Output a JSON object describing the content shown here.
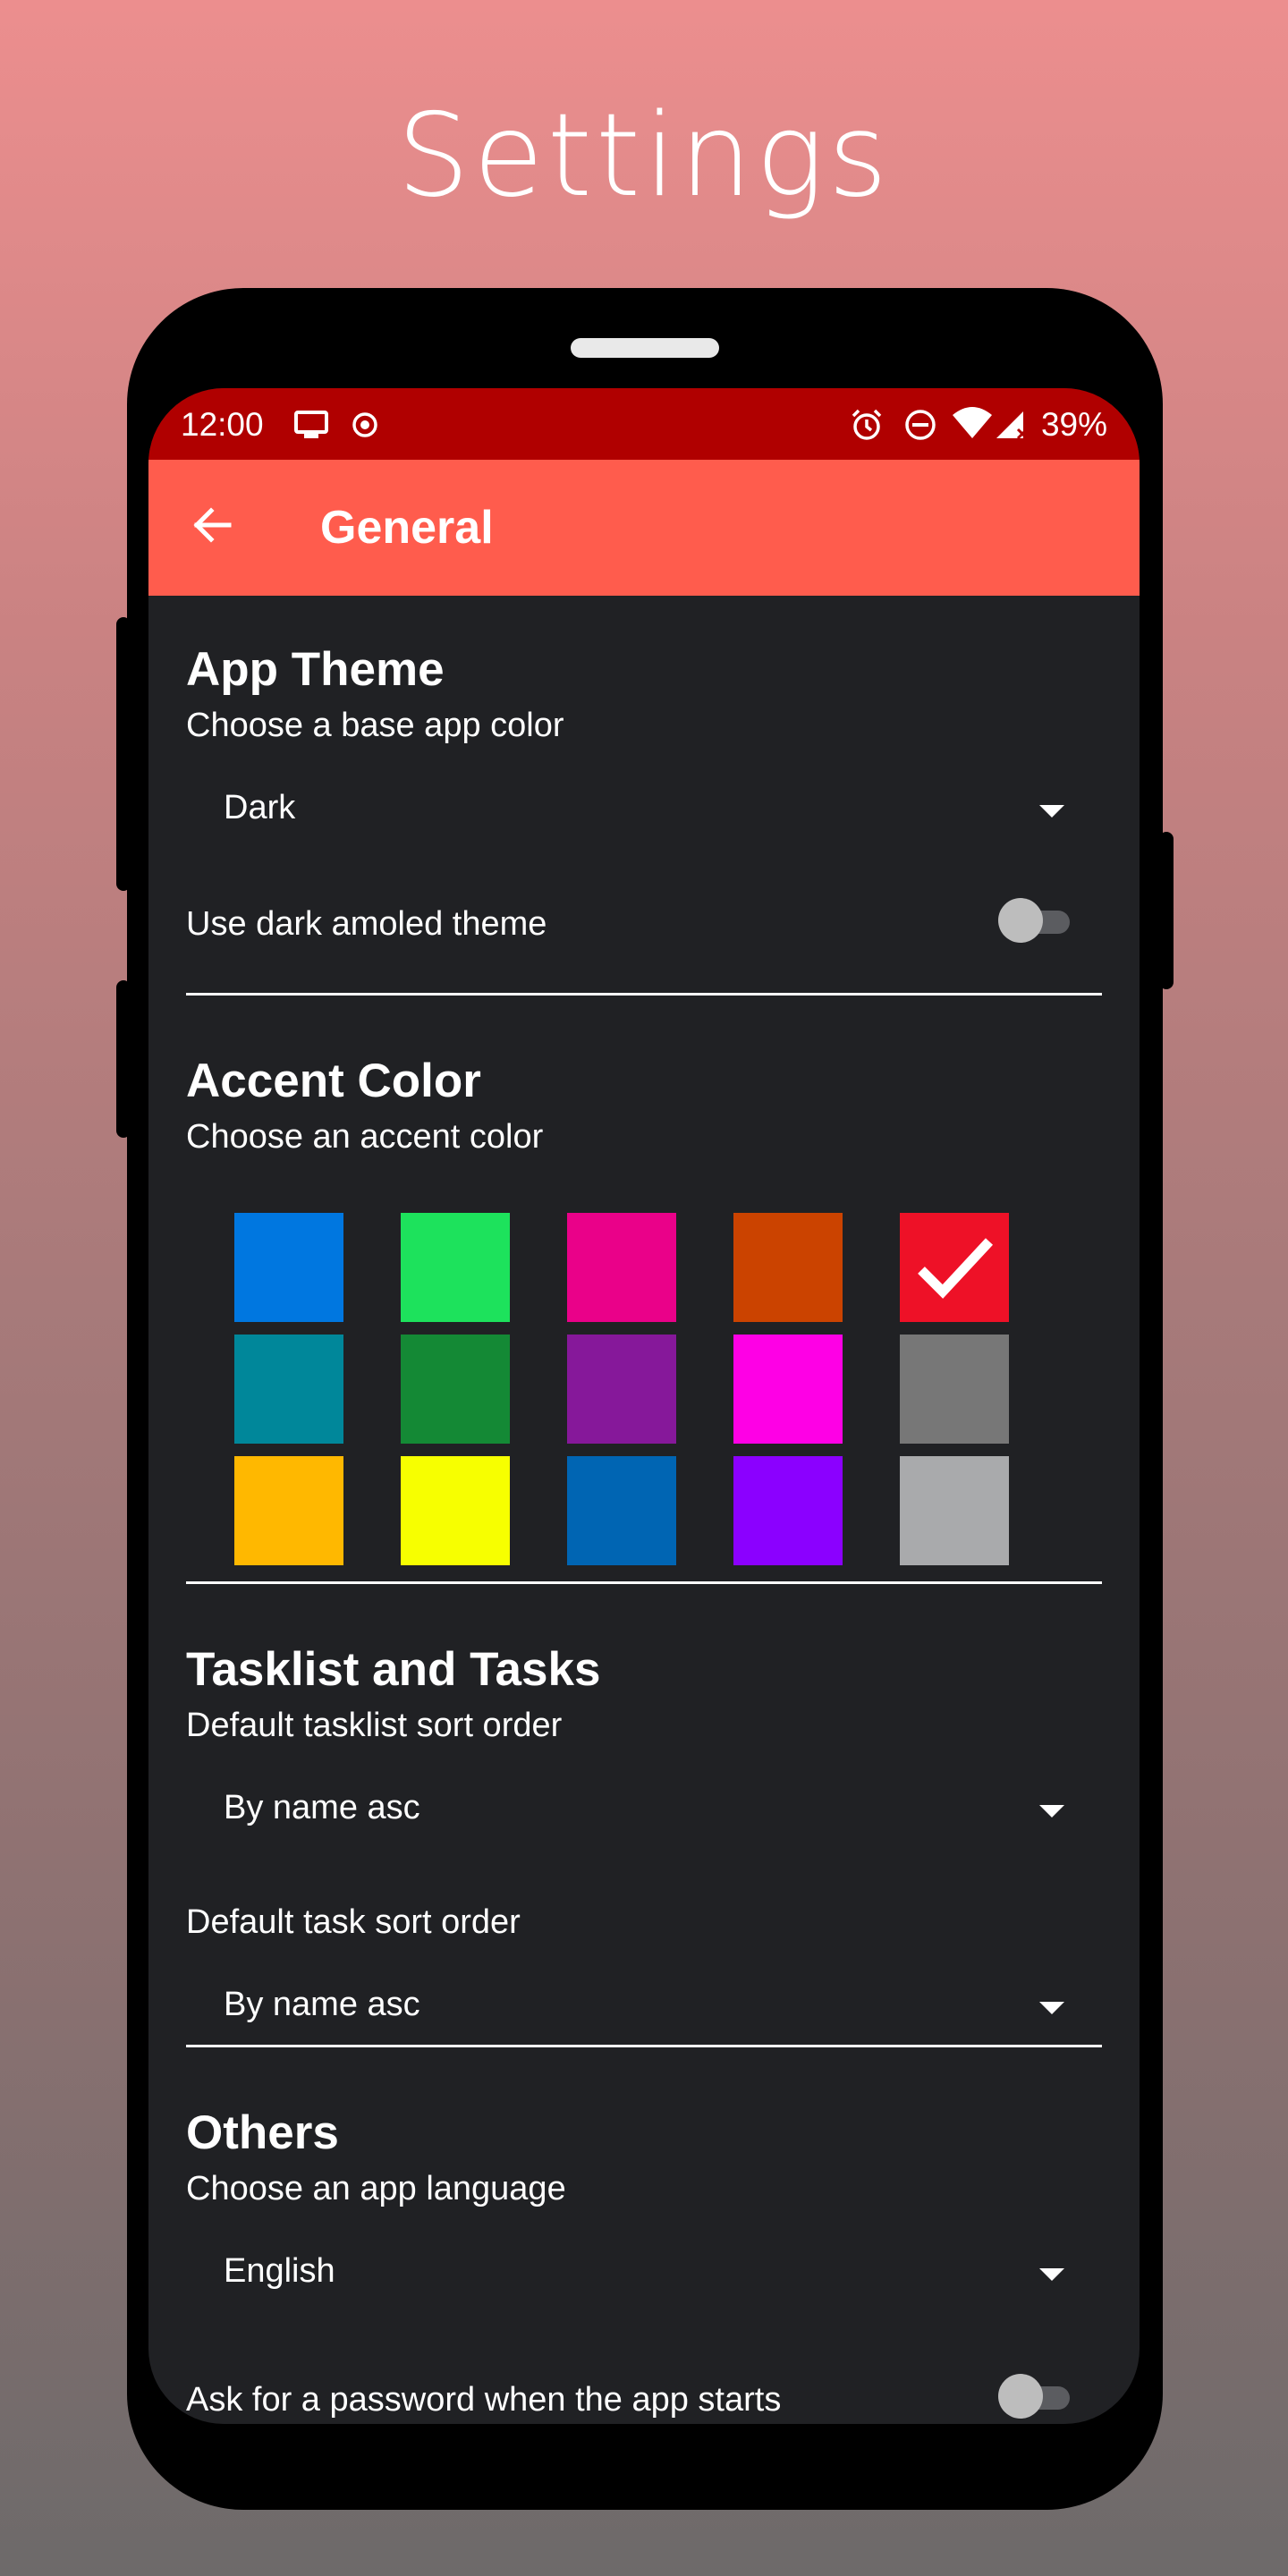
{
  "headline": "Settings",
  "status_bar": {
    "time": "12:00",
    "battery": "39%",
    "icons": [
      "screen-cast-icon",
      "record-icon",
      "alarm-icon",
      "do-not-disturb-icon",
      "wifi-icon",
      "signal-icon"
    ]
  },
  "app_bar": {
    "title": "General",
    "back_icon": "arrow-back-icon"
  },
  "app_theme": {
    "title": "App Theme",
    "subtitle": "Choose a base app color",
    "selected": "Dark",
    "amoled_label": "Use dark amoled theme",
    "amoled_enabled": false
  },
  "accent_color": {
    "title": "Accent Color",
    "subtitle": "Choose an accent color",
    "colors": [
      "#0077e0",
      "#1de25c",
      "#ea0189",
      "#cb4300",
      "#ee1127",
      "#00879a",
      "#148935",
      "#86189a",
      "#fe00e5",
      "#777777",
      "#ffb800",
      "#f7ff00",
      "#0065b3",
      "#8b00ff",
      "#a9aaac"
    ],
    "selected_index": 4
  },
  "tasklist": {
    "title": "Tasklist and Tasks",
    "subtitle": "Default tasklist sort order",
    "tasklist_sort": "By name asc",
    "task_sort_label": "Default task sort order",
    "task_sort": "By name asc"
  },
  "others": {
    "title": "Others",
    "subtitle": "Choose an app language",
    "language": "English",
    "partial_label": "Ask for a password when the app starts"
  }
}
